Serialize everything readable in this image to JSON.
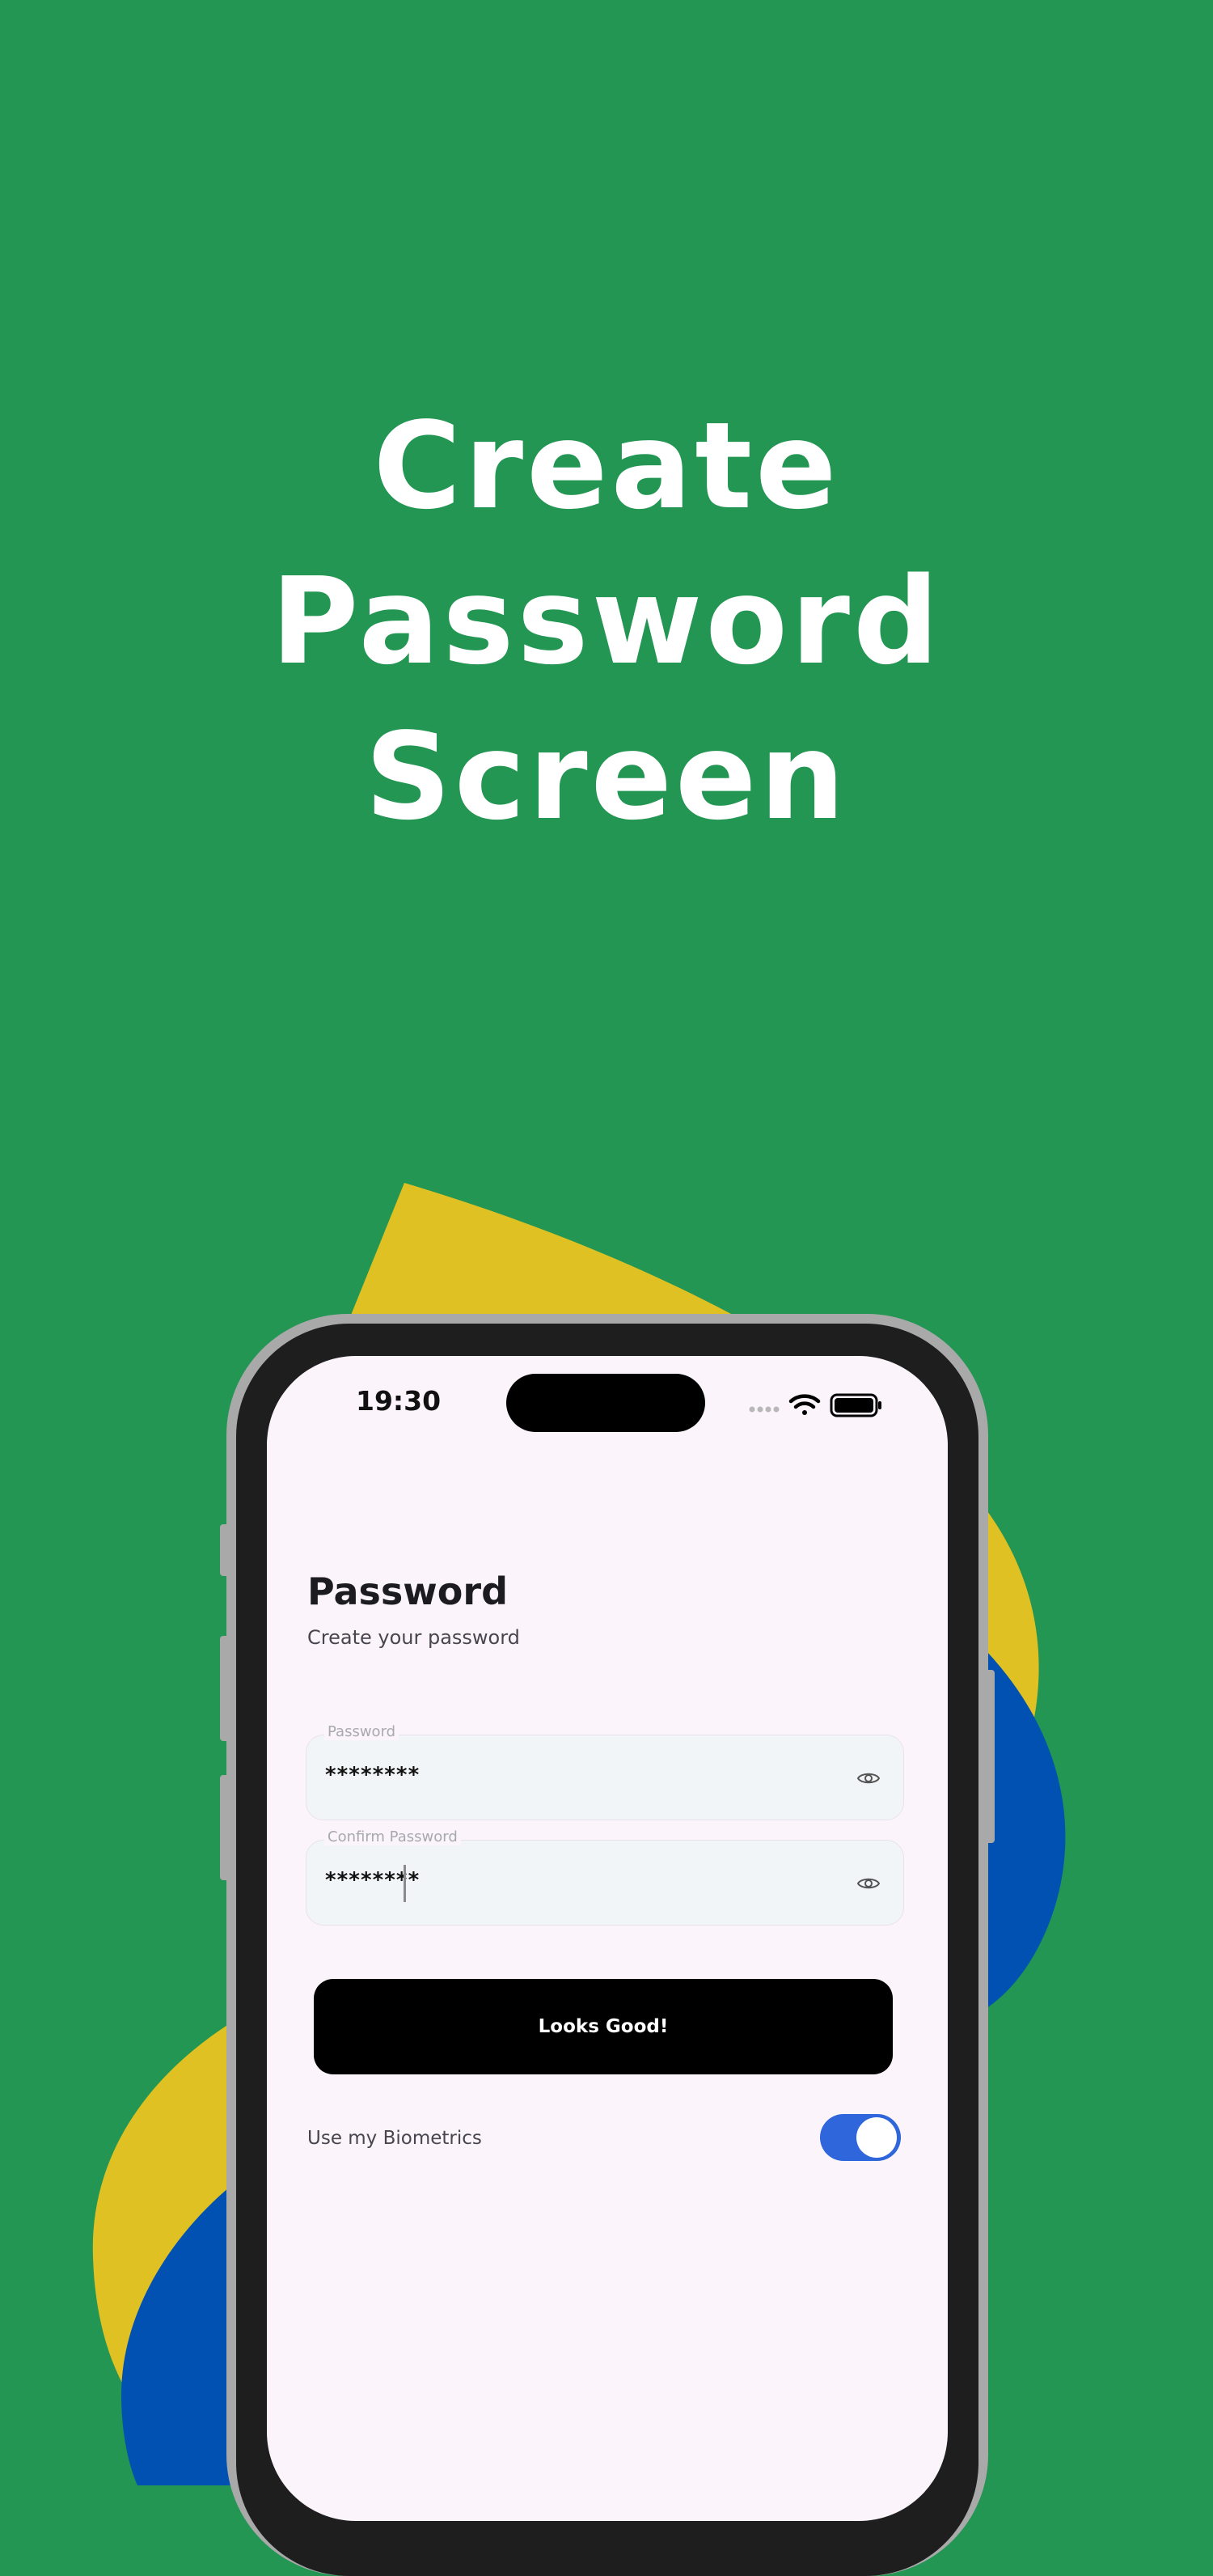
{
  "headline": {
    "line1": "Create",
    "line2": "Password",
    "line3": "Screen"
  },
  "status_bar": {
    "time": "19:30",
    "icons": [
      "signal-dots-icon",
      "wifi-icon",
      "battery-icon"
    ]
  },
  "screen": {
    "title": "Password",
    "subtitle": "Create your password",
    "password_field": {
      "label": "Password",
      "value": "********"
    },
    "confirm_field": {
      "label": "Confirm Password",
      "value": "********"
    },
    "submit_button": "Looks Good!",
    "biometrics": {
      "label": "Use my Biometrics",
      "enabled": true
    }
  },
  "colors": {
    "background": "#229652",
    "blob_yellow": "#E0C124",
    "blob_blue": "#0151B3",
    "screen_bg": "#FBF4FB",
    "button_bg": "#000000",
    "toggle_on": "#2F66DB"
  }
}
